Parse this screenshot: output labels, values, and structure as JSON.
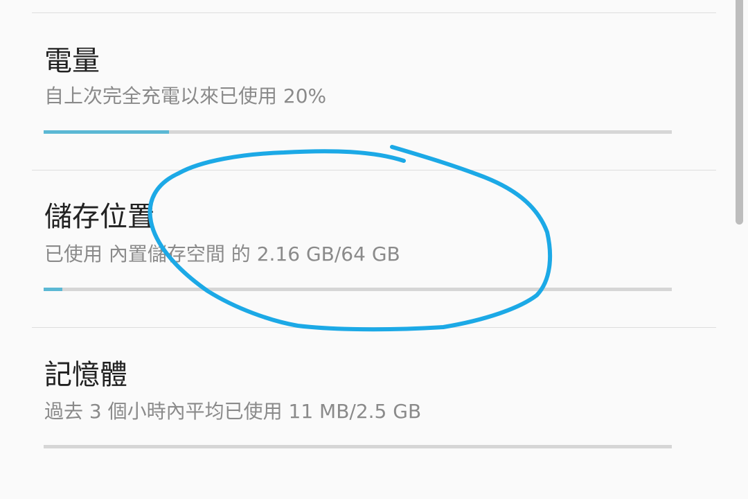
{
  "colors": {
    "accent": "#5bb8d4",
    "annotation": "#1ca9e6"
  },
  "settings": [
    {
      "title": "電量",
      "summary": "自上次完全充電以來已使用 20%",
      "progress": 0.2
    },
    {
      "title": "儲存位置",
      "summary": "已使用 內置儲存空間 的 2.16 GB/64 GB",
      "progress": 0.03
    },
    {
      "title": "記憶體",
      "summary": "過去 3 個小時內平均已使用 11 MB/2.5 GB",
      "progress": 0.0
    }
  ]
}
